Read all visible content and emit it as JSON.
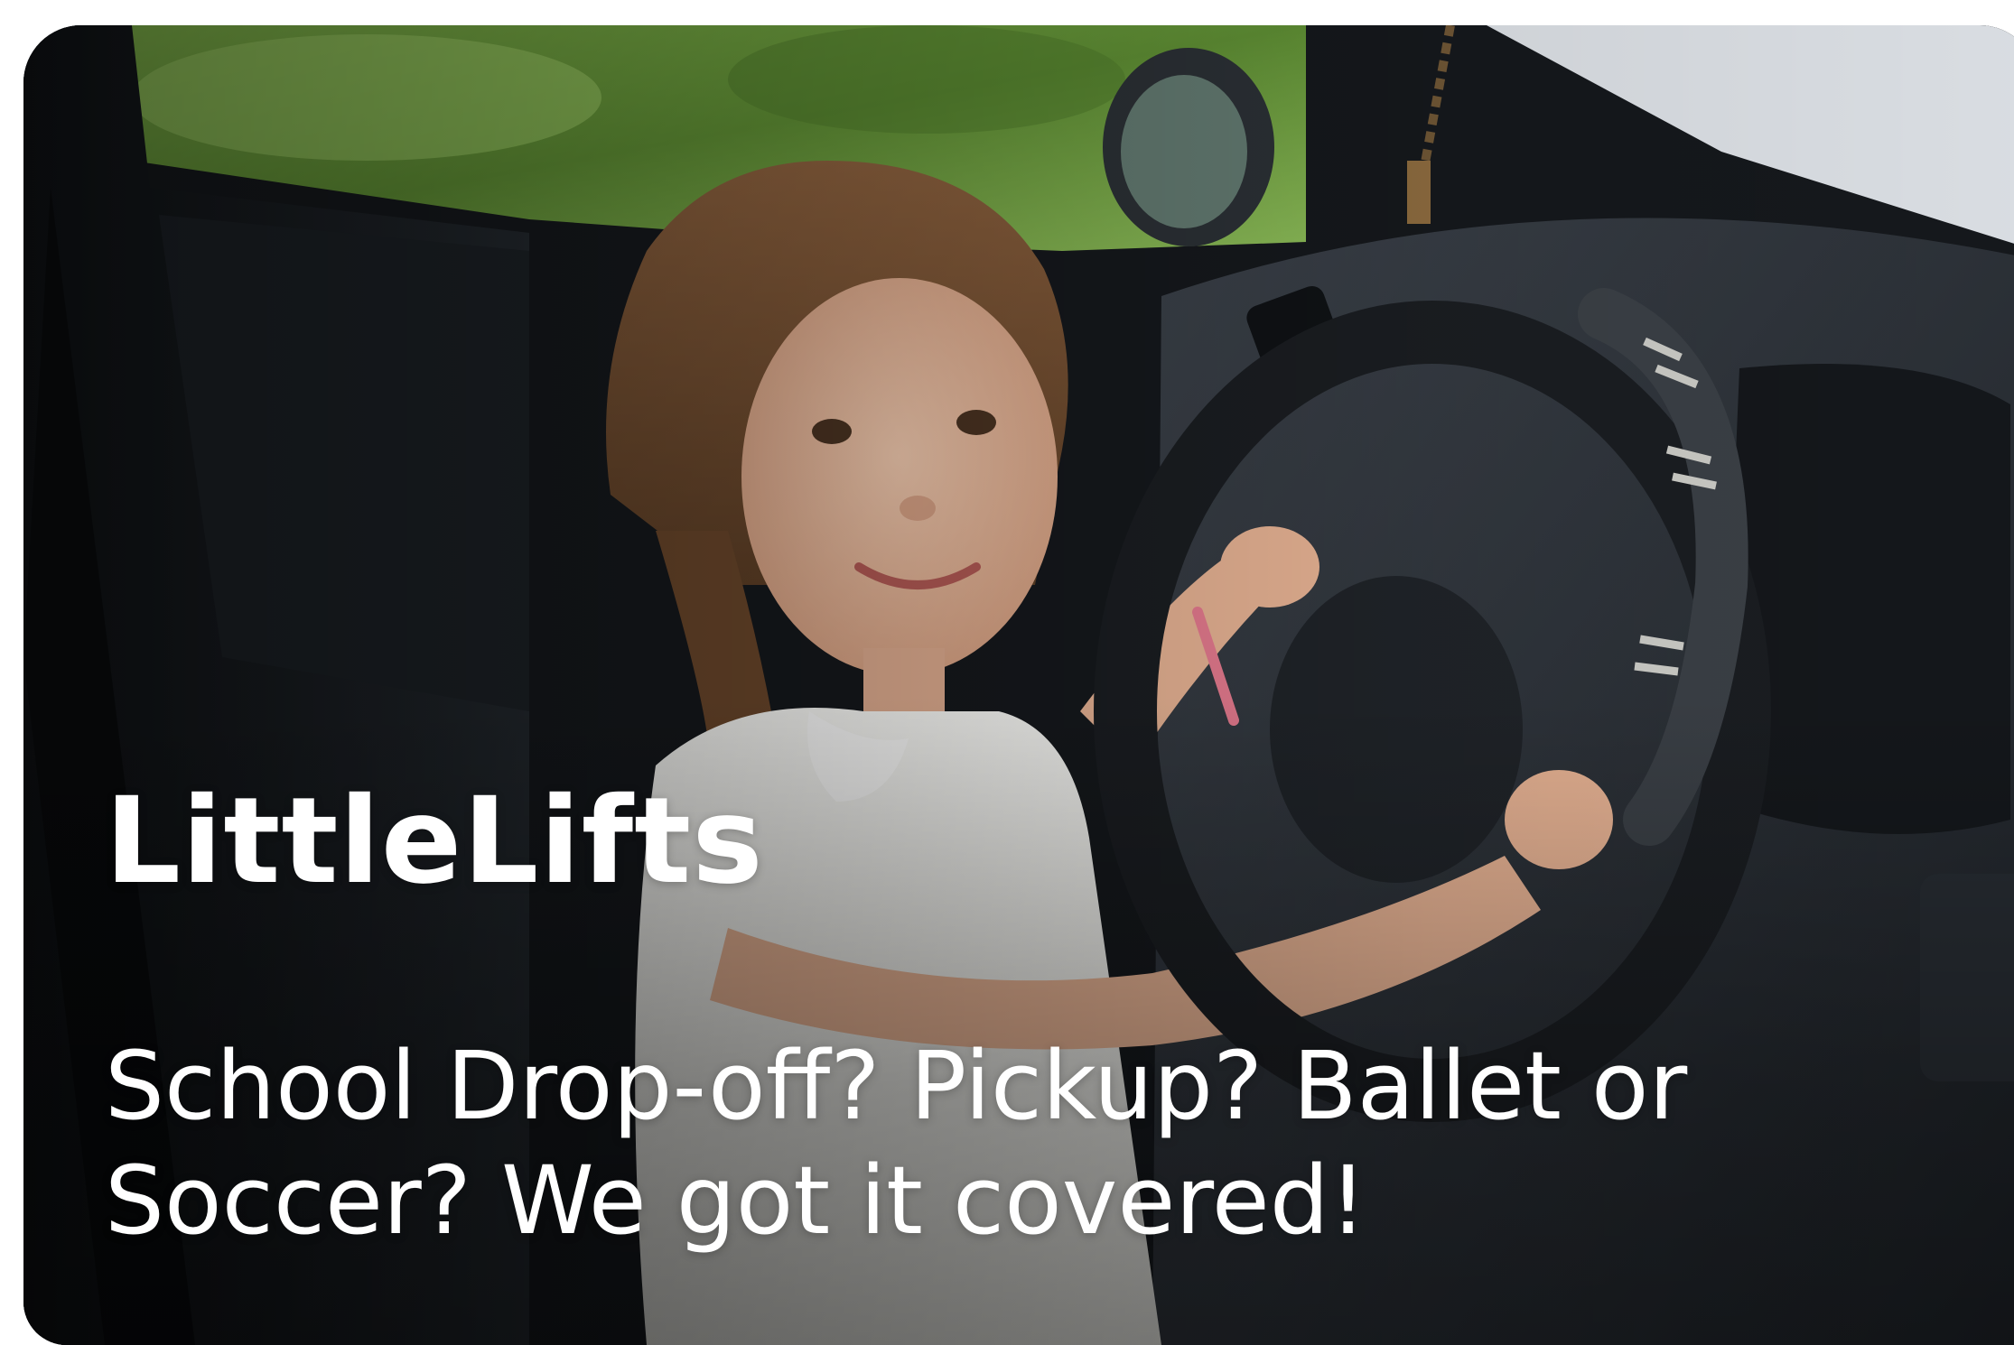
{
  "hero": {
    "brand_name": "LittleLifts",
    "tagline_line1": "School Drop-off? Pickup? Ballet or",
    "tagline_line2": "Soccer? We got it covered!",
    "image_subject": "child-at-steering-wheel-photo"
  },
  "colors": {
    "text": "#ffffff",
    "foliage": "#6f9f3c",
    "interior_dark": "#15181c",
    "dashboard": "#2a2f36",
    "skin": "#e8b89a",
    "hair": "#7a5334",
    "dress": "#f1f1ee",
    "bracelet": "#e47a8e"
  }
}
